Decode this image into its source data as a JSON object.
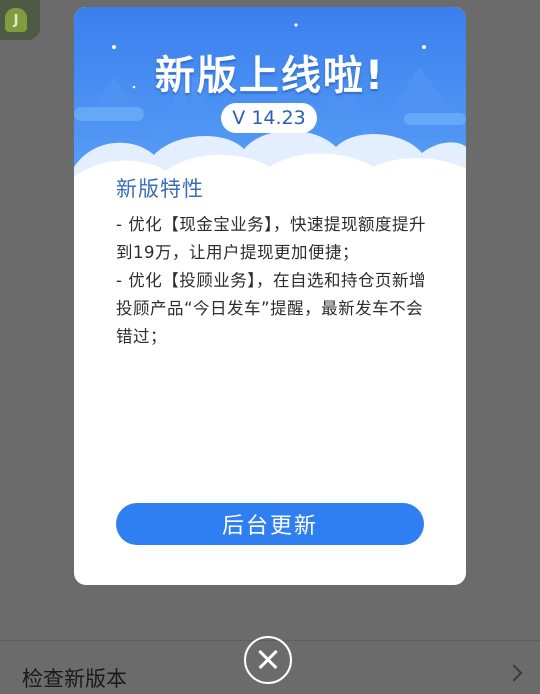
{
  "background_screen": {
    "list_item_label": "检查新版本"
  },
  "dialog": {
    "headline": "新版上线啦!",
    "version": "V 14.23",
    "section_title": "新版特性",
    "notes": [
      "- 优化【现金宝业务】，快速提现额度提升到19万，让用户提现更加便捷；",
      "- 优化【投顾业务】，在自选和持仓页新增投顾产品“今日发车”提醒，最新发车不会错过；"
    ],
    "update_button_label": "后台更新"
  },
  "colors": {
    "banner_blue": "#3d86f0",
    "button_blue": "#2f7ff3",
    "title_blue": "#3c6fb8",
    "overlay_gray": "#6b6b6b"
  },
  "icons": {
    "app": "android-icon",
    "close": "close-icon",
    "chevron": "chevron-right-icon"
  }
}
